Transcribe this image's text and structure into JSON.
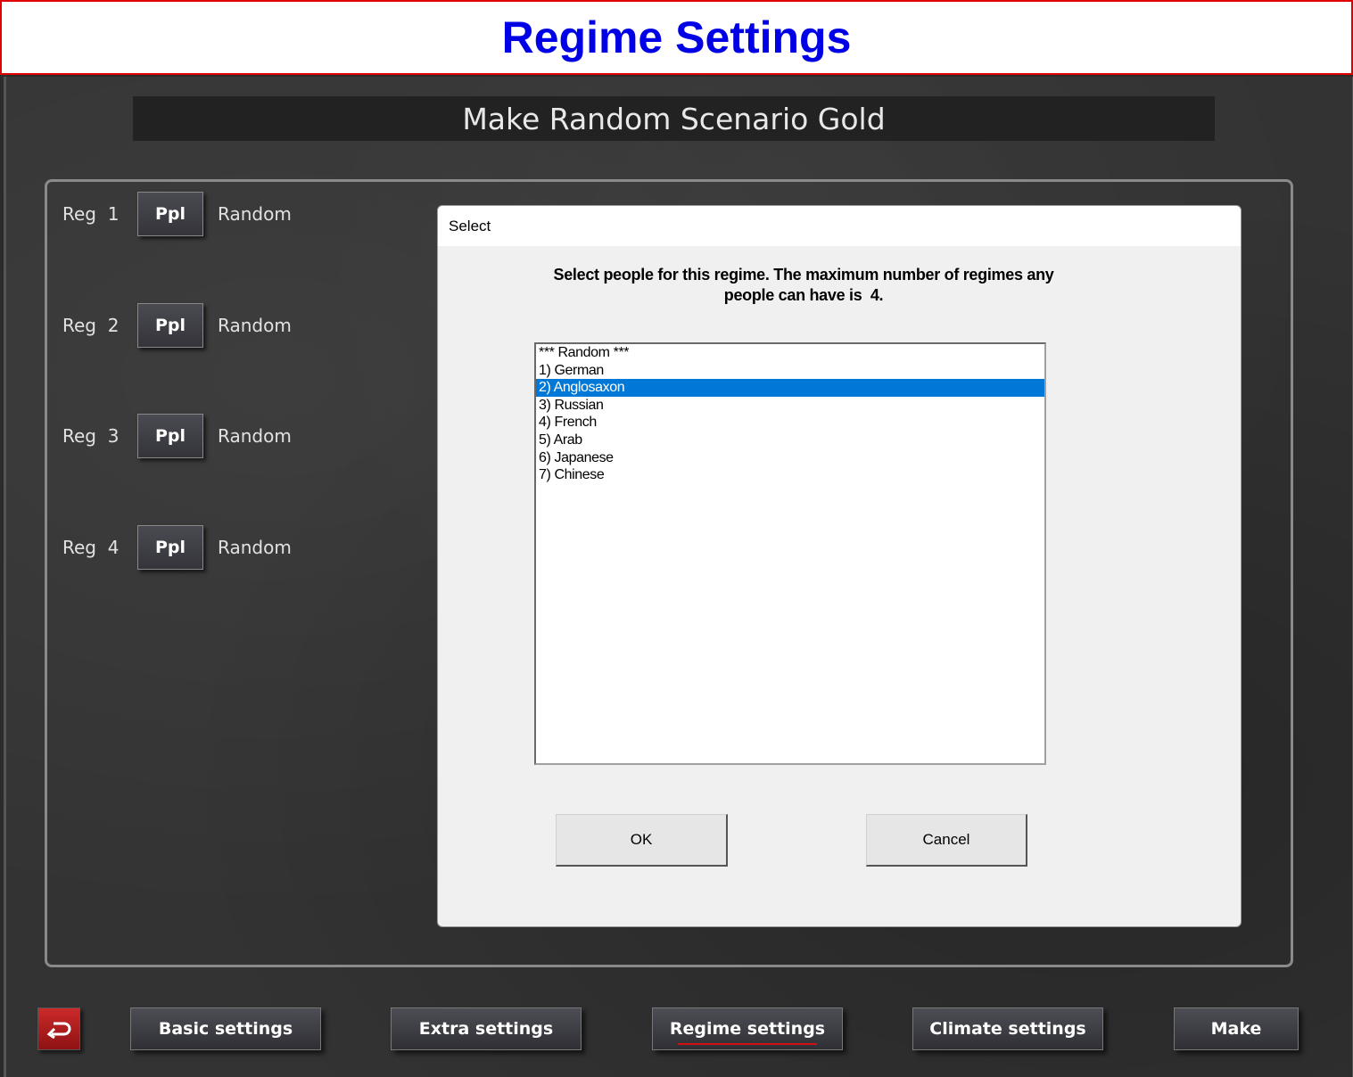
{
  "banner": {
    "title": "Regime Settings"
  },
  "app": {
    "title": "Make Random Scenario Gold"
  },
  "regimes": [
    {
      "label": "Reg  1",
      "button": "Ppl",
      "value": "Random"
    },
    {
      "label": "Reg  2",
      "button": "Ppl",
      "value": "Random"
    },
    {
      "label": "Reg  3",
      "button": "Ppl",
      "value": "Random"
    },
    {
      "label": "Reg  4",
      "button": "Ppl",
      "value": "Random"
    }
  ],
  "dialog": {
    "title": "Select",
    "message_line1": "Select people for this regime. The maximum number of regimes any",
    "message_line2": "people can have is  4.",
    "items": [
      "*** Random ***",
      "1) German",
      "2) Anglosaxon",
      "3) Russian",
      "4) French",
      "5) Arab",
      "6) Japanese",
      "7) Chinese"
    ],
    "selected_index": 2,
    "ok_label": "OK",
    "cancel_label": "Cancel"
  },
  "bottom_nav": {
    "back_icon": "return-arrow-icon",
    "basic_label": "Basic settings",
    "extra_label": "Extra settings",
    "regime_label": "Regime settings",
    "climate_label": "Climate settings",
    "make_label": "Make",
    "active": "regime"
  },
  "colors": {
    "banner_text": "#0000e6",
    "banner_border": "#e00000",
    "selection": "#0078d7",
    "active_underline": "#d01010"
  }
}
